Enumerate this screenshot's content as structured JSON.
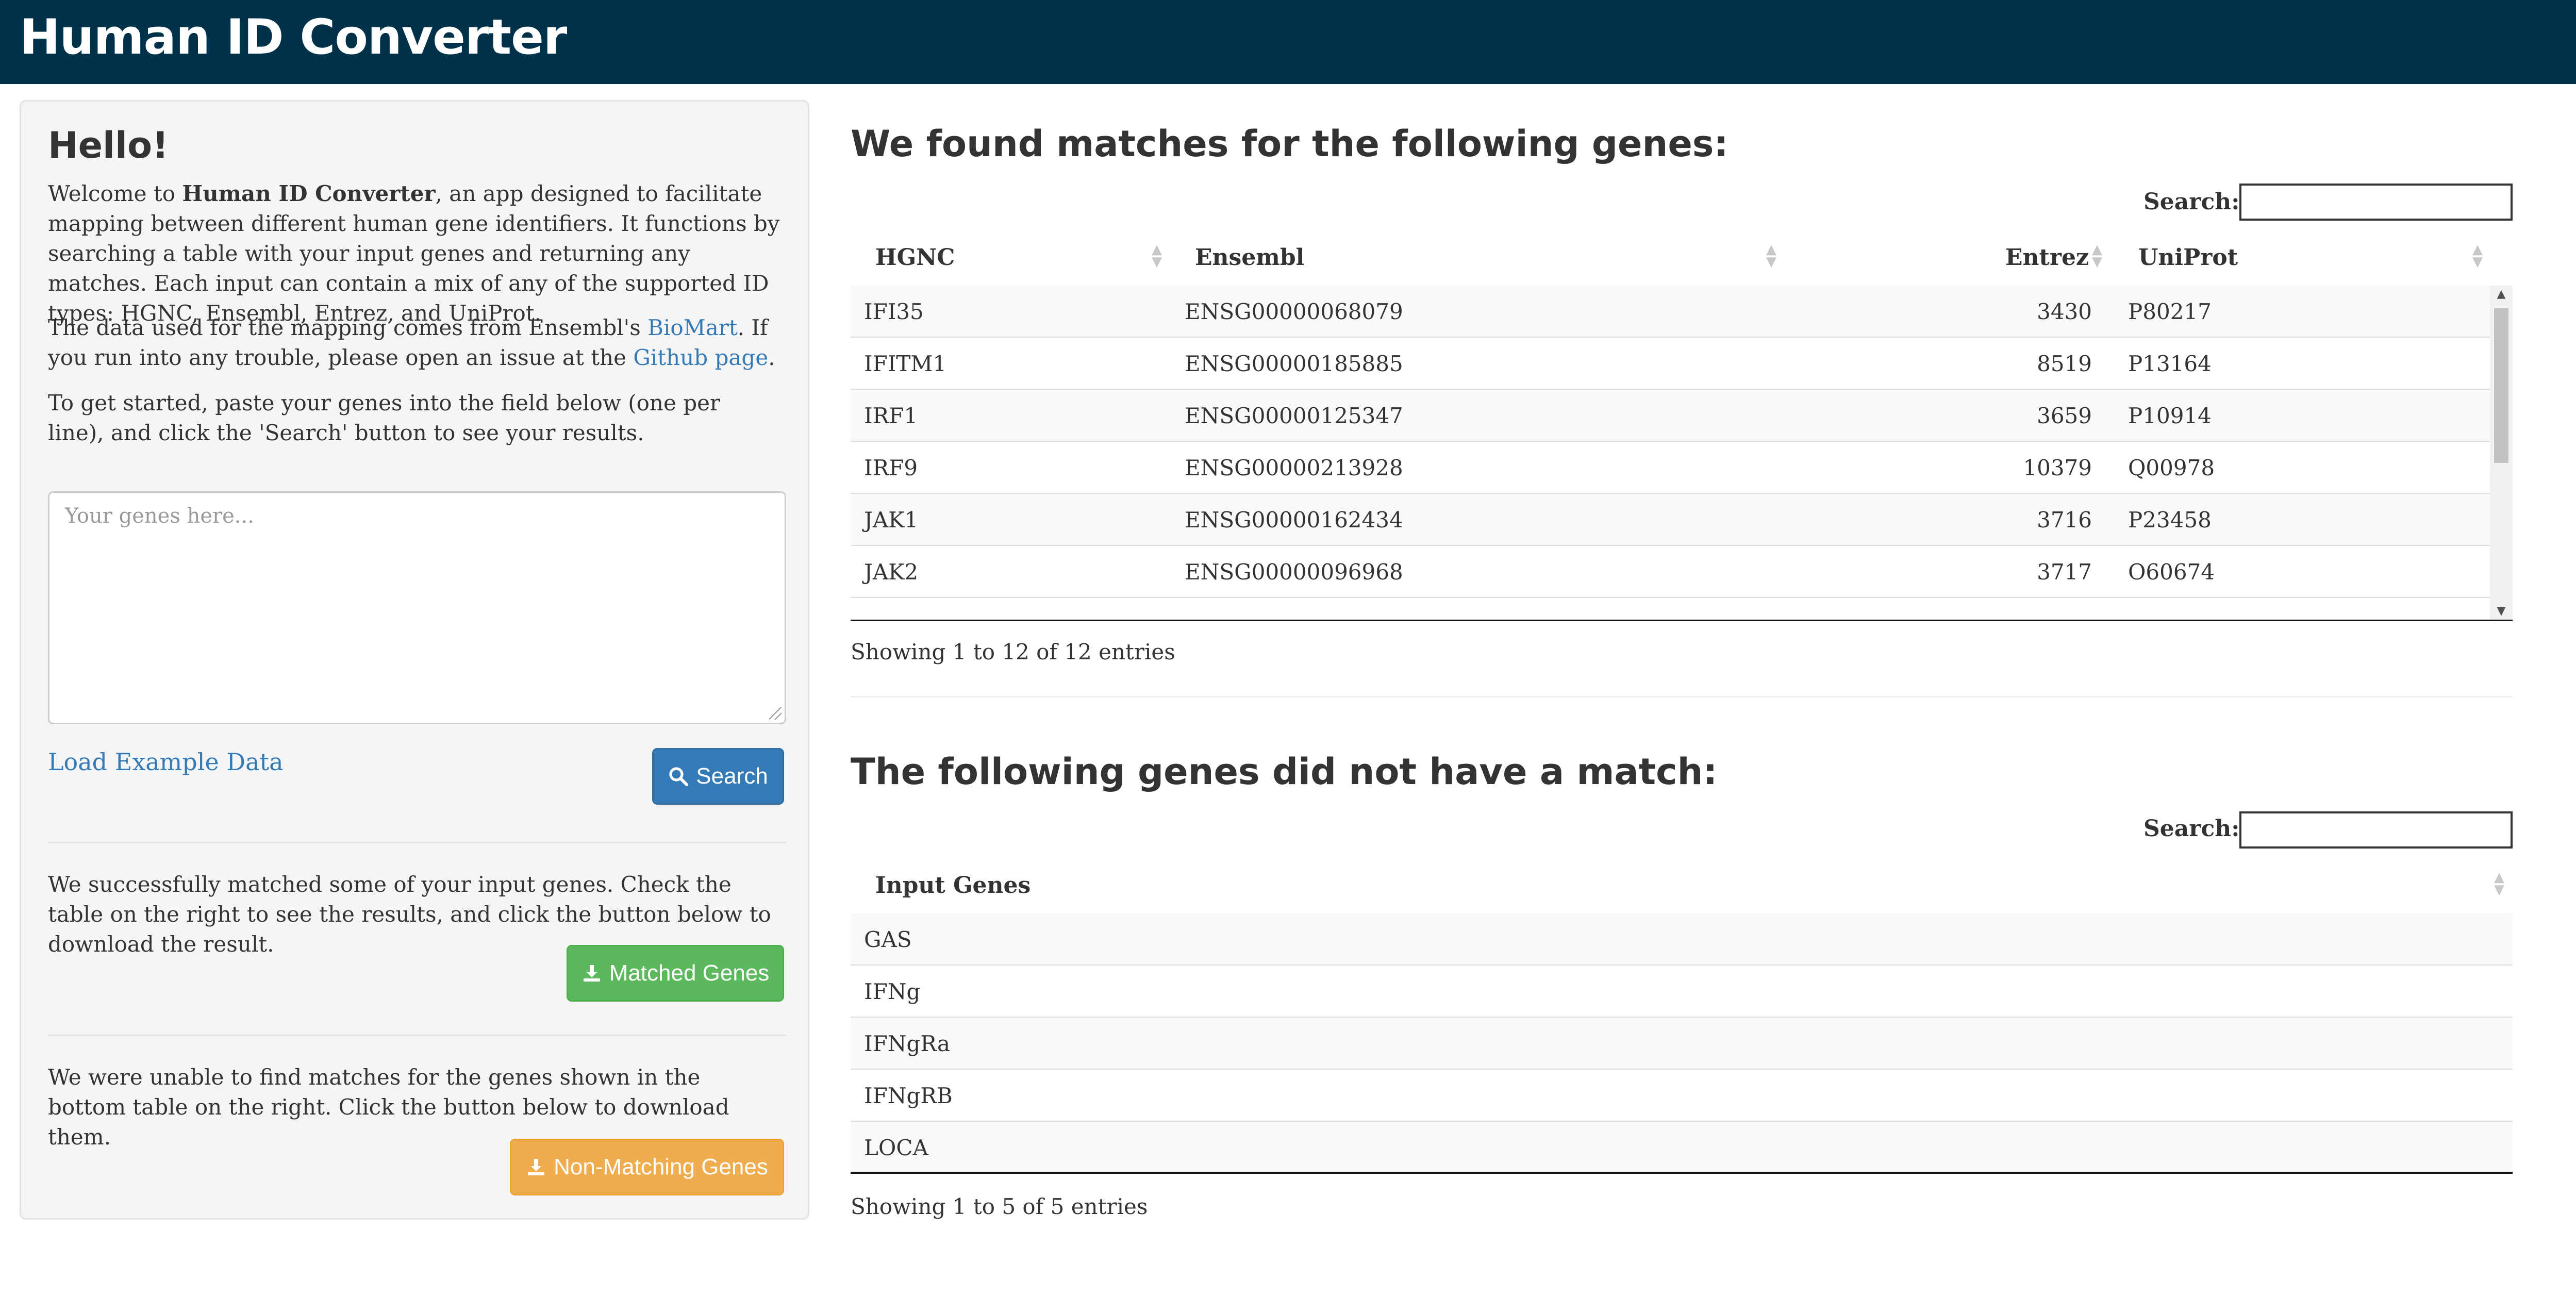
{
  "app": {
    "title": "Human ID Converter"
  },
  "sidebar": {
    "heading": "Hello!",
    "intro_1": "Welcome to ",
    "intro_bold": "Human ID Converter",
    "intro_2": ", an app designed to facilitate mapping between different human gene identifiers. It functions by searching a table with your input genes and returning any matches. Each input can contain a mix of any of the supported ID types: HGNC, Ensembl, Entrez, and UniProt.",
    "data_1": "The data used for the mapping comes from Ensembl's ",
    "data_link_biomart": "BioMart",
    "data_2": ". If you run into any trouble, please open an issue at the ",
    "data_link_github": "Github page",
    "data_3": ".",
    "instructions": "To get started, paste your genes into the field below (one per line), and click the 'Search' button to see your results.",
    "genes_placeholder": "Your genes here...",
    "load_example_label": "Load Example Data",
    "search_button_label": "Search",
    "matched_message": "We successfully matched some of your input genes. Check the table on the right to see the results, and click the button below to download the result.",
    "matched_button_label": "Matched Genes",
    "nonmatch_message": "We were unable to find matches for the genes shown in the bottom table on the right. Click the button below to download them.",
    "nonmatch_button_label": "Non-Matching Genes"
  },
  "matches": {
    "heading": "We found matches for the following genes:",
    "search_label": "Search:",
    "columns": [
      "HGNC",
      "Ensembl",
      "Entrez",
      "UniProt"
    ],
    "rows": [
      [
        "IFI35",
        "ENSG00000068079",
        "3430",
        "P80217"
      ],
      [
        "IFITM1",
        "ENSG00000185885",
        "8519",
        "P13164"
      ],
      [
        "IRF1",
        "ENSG00000125347",
        "3659",
        "P10914"
      ],
      [
        "IRF9",
        "ENSG00000213928",
        "10379",
        "Q00978"
      ],
      [
        "JAK1",
        "ENSG00000162434",
        "3716",
        "P23458"
      ],
      [
        "JAK2",
        "ENSG00000096968",
        "3717",
        "O60674"
      ]
    ],
    "info": "Showing 1 to 12 of 12 entries"
  },
  "nonmatches": {
    "heading": "The following genes did not have a match:",
    "search_label": "Search:",
    "columns": [
      "Input Genes"
    ],
    "rows": [
      "GAS",
      "IFNg",
      "IFNgRa",
      "IFNgRB",
      "LOCA"
    ],
    "info": "Showing 1 to 5 of 5 entries"
  },
  "colors": {
    "header_bg": "#00314a",
    "primary": "#337ab7",
    "success": "#5cb85c",
    "warning": "#f0ad4e"
  }
}
